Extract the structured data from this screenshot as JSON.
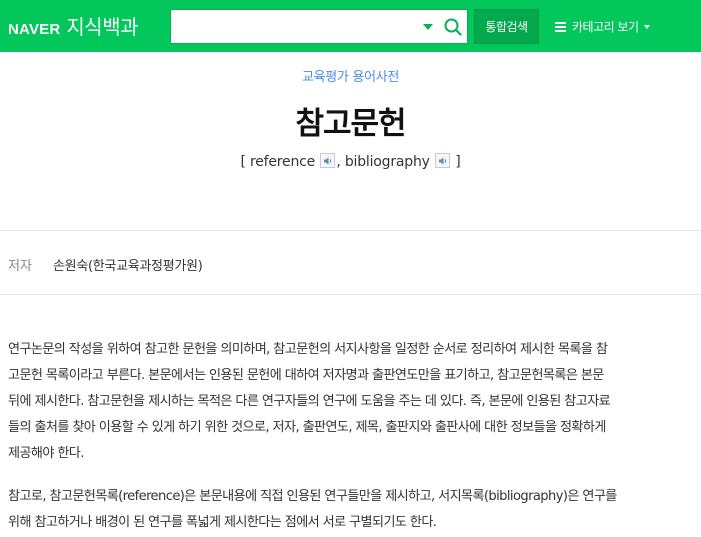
{
  "header": {
    "brand_naver": "NAVER",
    "brand_service": "지식백과",
    "search": {
      "value": "",
      "placeholder": ""
    },
    "total_search_label": "통합검색",
    "category_label": "카테고리 보기",
    "accent_color": "#03c75a"
  },
  "entry": {
    "dictionary": "교육평가 용어사전",
    "title": "참고문헌",
    "original_terms": {
      "open_bracket": "[",
      "term1": "reference",
      "separator": ",",
      "term2": "bibliography",
      "close_bracket": "]"
    },
    "author_label": "저자",
    "author": "손원숙(한국교육과정평가원)"
  },
  "body": {
    "paragraph1": [
      "연구논문의 작성을 위하여 참고한 문헌을 의미하며, 참고문헌의 서지사항을 일정한 순서로 정리하여 제시한 목록을 참",
      "고문헌 목록이라고 부른다. 본문에서는 인용된 문헌에 대하여 저자명과 출판연도만을 표기하고, 참고문헌목록은 본문",
      "뒤에 제시한다. 참고문헌을 제시하는 목적은 다른 연구자들의 연구에 도움을 주는 데 있다. 즉, 본문에 인용된 참고자료",
      "들의 출처를 찾아 이용할 수 있게 하기 위한 것으로, 저자, 출판연도, 제목, 출판지와 출판사에 대한 정보들을 정확하게",
      "제공해야 한다."
    ],
    "paragraph2": [
      "참고로, 참고문헌목록(reference)은 본문내용에 직접 인용된 연구들만을 제시하고, 서지목록(bibliography)은 연구를",
      "위해 참고하거나 배경이 된 연구를 폭넓게 제시한다는 점에서 서로 구별되기도 한다."
    ]
  }
}
